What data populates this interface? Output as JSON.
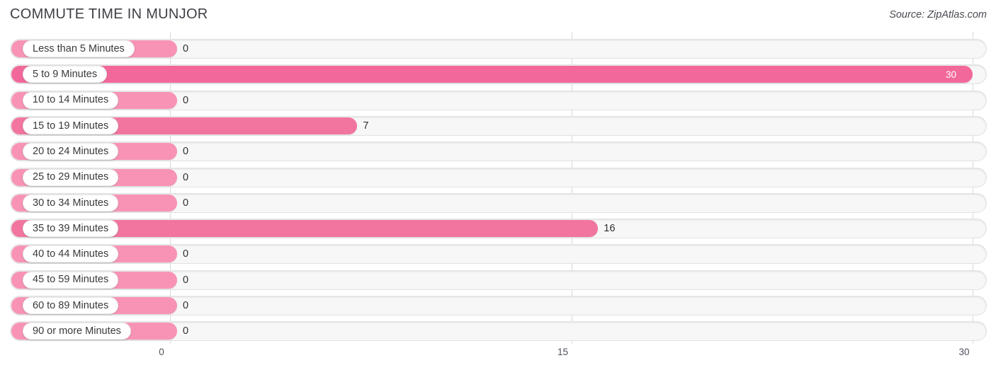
{
  "header": {
    "title": "COMMUTE TIME IN MUNJOR",
    "source": "Source: ZipAtlas.com"
  },
  "colors": {
    "bar_strong": "#f2689a",
    "bar_light": "#f893b6",
    "track_bg": "#f7f7f7",
    "track_border": "#e3e3e3",
    "gridline": "#d8d8d8",
    "value_text": "#2f2f33",
    "value_text_inside": "#ffffff"
  },
  "chart_data": {
    "type": "bar",
    "orientation": "horizontal",
    "title": "COMMUTE TIME IN MUNJOR",
    "xlabel": "",
    "ylabel": "",
    "xlim": [
      0,
      30
    ],
    "grid": true,
    "legend": null,
    "axis_ticks": [
      "0",
      "15",
      "30"
    ],
    "axis_tick_values": [
      0,
      15,
      30
    ],
    "categories": [
      "Less than 5 Minutes",
      "5 to 9 Minutes",
      "10 to 14 Minutes",
      "15 to 19 Minutes",
      "20 to 24 Minutes",
      "25 to 29 Minutes",
      "30 to 34 Minutes",
      "35 to 39 Minutes",
      "40 to 44 Minutes",
      "45 to 59 Minutes",
      "60 to 89 Minutes",
      "90 or more Minutes"
    ],
    "values": [
      0,
      30,
      0,
      7,
      0,
      0,
      0,
      16,
      0,
      0,
      0,
      0
    ],
    "value_labels": [
      "0",
      "30",
      "0",
      "7",
      "0",
      "0",
      "0",
      "16",
      "0",
      "0",
      "0",
      "0"
    ]
  },
  "rows": [
    {
      "label": "Less than 5 Minutes",
      "value": 0,
      "value_label": "0",
      "inside": false
    },
    {
      "label": "5 to 9 Minutes",
      "value": 30,
      "value_label": "30",
      "inside": true
    },
    {
      "label": "10 to 14 Minutes",
      "value": 0,
      "value_label": "0",
      "inside": false
    },
    {
      "label": "15 to 19 Minutes",
      "value": 7,
      "value_label": "7",
      "inside": false
    },
    {
      "label": "20 to 24 Minutes",
      "value": 0,
      "value_label": "0",
      "inside": false
    },
    {
      "label": "25 to 29 Minutes",
      "value": 0,
      "value_label": "0",
      "inside": false
    },
    {
      "label": "30 to 34 Minutes",
      "value": 0,
      "value_label": "0",
      "inside": false
    },
    {
      "label": "35 to 39 Minutes",
      "value": 16,
      "value_label": "16",
      "inside": false
    },
    {
      "label": "40 to 44 Minutes",
      "value": 0,
      "value_label": "0",
      "inside": false
    },
    {
      "label": "45 to 59 Minutes",
      "value": 0,
      "value_label": "0",
      "inside": false
    },
    {
      "label": "60 to 89 Minutes",
      "value": 0,
      "value_label": "0",
      "inside": false
    },
    {
      "label": "90 or more Minutes",
      "value": 0,
      "value_label": "0",
      "inside": false
    }
  ]
}
